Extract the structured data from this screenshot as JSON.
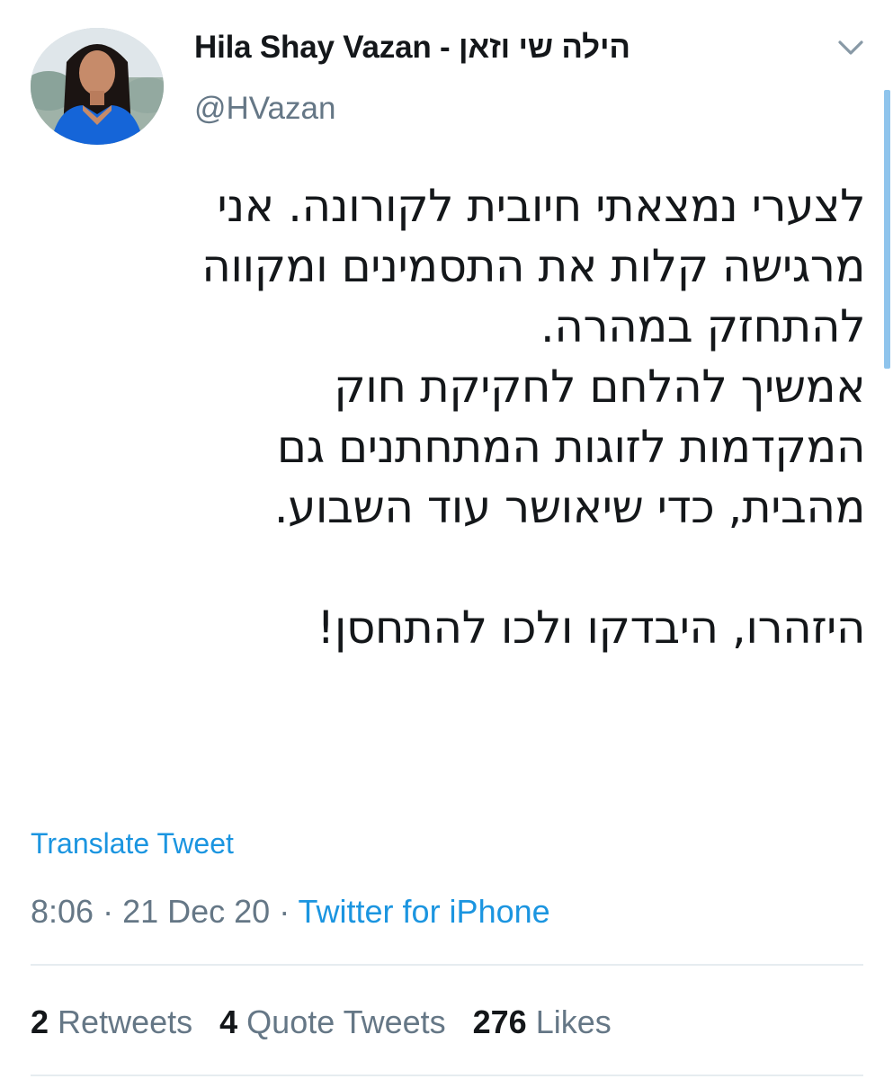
{
  "author": {
    "display_name": "Hila Shay Vazan - הילה שי וזאן",
    "handle": "@HVazan",
    "avatar_icon": "profile-photo"
  },
  "tweet": {
    "text": "לצערי נמצאתי חיובית לקורונה. אני\nמרגישה קלות את התסמינים ומקווה\nלהתחזק במהרה.\nאמשיך להלחם לחקיקת חוק\nהמקדמות לזוגות המתחתנים גם\nמהבית, כדי שיאושר עוד השבוע.\n\nהיזהרו, היבדקו ולכו להתחסן!",
    "translate_label": "Translate Tweet",
    "time": "8:06",
    "date": "21 Dec 20",
    "separator": " · ",
    "source": "Twitter for iPhone"
  },
  "stats": {
    "retweets_count": "2",
    "retweets_label": "Retweets",
    "quote_count": "4",
    "quote_label": "Quote Tweets",
    "likes_count": "276",
    "likes_label": "Likes"
  },
  "colors": {
    "link": "#1b95e0",
    "secondary_text": "#657786",
    "primary_text": "#14171a",
    "divider": "#e6ecf0"
  }
}
